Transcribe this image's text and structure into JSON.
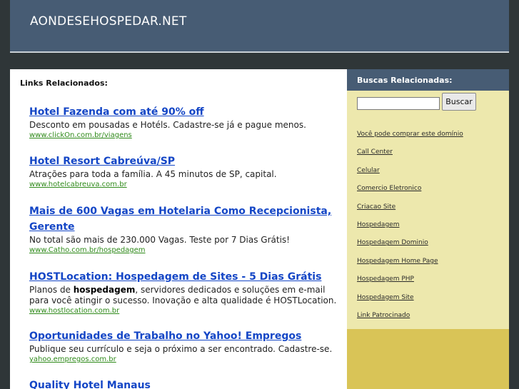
{
  "header": {
    "site_title": "AONDESEHOSPEDAR.NET"
  },
  "main": {
    "heading": "Links Relacionados:",
    "ads": [
      {
        "title": "Hotel Fazenda com até 90% off",
        "desc": "Desconto em pousadas e Hotéls. Cadastre-se já e pague menos.",
        "url": "www.clickOn.com.br/viagens"
      },
      {
        "title": "Hotel Resort Cabreúva/SP",
        "desc": "Atrações para toda a família. A 45 minutos de SP, capital.",
        "url": "www.hotelcabreuva.com.br"
      },
      {
        "title": "Mais de 600 Vagas em Hotelaria Como Recepcionista, Gerente",
        "desc": "No total são mais de 230.000 Vagas. Teste por 7 Dias Grátis!",
        "url": "www.Catho.com.br/hospedagem"
      },
      {
        "title": "HOSTLocation: Hospedagem de Sites - 5 Dias Grátis",
        "desc_before": "Planos de ",
        "desc_bold": "hospedagem",
        "desc_after": ", servidores dedicados e soluções em e-mail para você atingir o sucesso. Inovação e alta qualidade é HOSTLocation.",
        "url": "www.hostlocation.com.br"
      },
      {
        "title": "Oportunidades de Trabalho no Yahoo! Empregos",
        "desc": "Publique seu currículo e seja o próximo a ser encontrado. Cadastre-se.",
        "url": "yahoo.empregos.com.br"
      },
      {
        "title": "Quality Hotel Manaus"
      }
    ]
  },
  "sidebar": {
    "heading": "Buscas Relacionadas:",
    "search_button": "Buscar",
    "search_value": "",
    "links": [
      "Você pode comprar este domínio",
      "Call Center",
      "Celular",
      "Comercio Eletronico",
      "Criacao Site",
      "Hospedagem",
      "Hospedagem Dominio",
      "Hospedagem Home Page",
      "Hospedagem PHP",
      "Hospedagem Site",
      "Link Patrocinado"
    ]
  },
  "colors": {
    "background": "#2f3638",
    "header": "#475c74",
    "ad_title": "#1446c6",
    "ad_url": "#2f8a1a",
    "sidebar_list": "#ede8ad",
    "sidebar_bottom": "#d9c457"
  }
}
